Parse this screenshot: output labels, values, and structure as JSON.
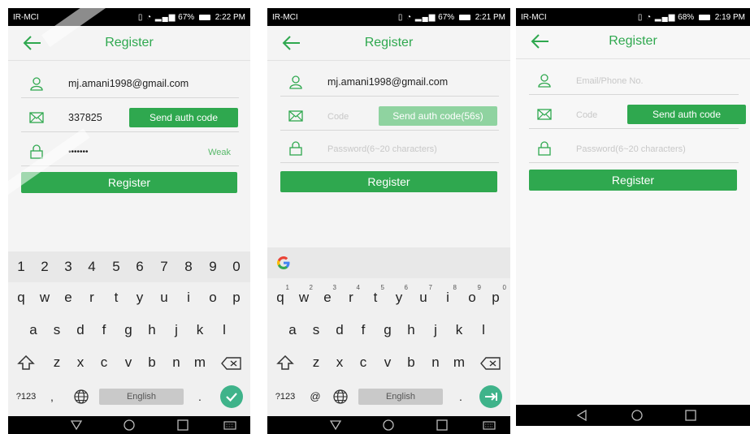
{
  "screens": [
    {
      "status": {
        "carrier": "IR-MCI",
        "battery": "67%",
        "time": "2:22 PM"
      },
      "header": {
        "title": "Register"
      },
      "email_value": "mj.amani1998@gmail.com",
      "code_value": "337825",
      "auth_button": "Send auth code",
      "password_value": "•••••••",
      "strength": "Weak",
      "register_button": "Register"
    },
    {
      "status": {
        "carrier": "IR-MCI",
        "battery": "67%",
        "time": "2:21 PM"
      },
      "header": {
        "title": "Register"
      },
      "email_value": "mj.amani1998@gmail.com",
      "code_placeholder": "Code",
      "auth_button": "Send auth code(56s)",
      "password_placeholder": "Password(6~20 characters)",
      "register_button": "Register"
    },
    {
      "status": {
        "carrier": "IR-MCI",
        "battery": "68%",
        "time": "2:19 PM"
      },
      "header": {
        "title": "Register"
      },
      "email_placeholder": "Email/Phone No.",
      "code_placeholder": "Code",
      "auth_button": "Send auth code",
      "password_placeholder": "Password(6~20 characters)",
      "register_button": "Register"
    }
  ],
  "keyboard": {
    "numbers": [
      "1",
      "2",
      "3",
      "4",
      "5",
      "6",
      "7",
      "8",
      "9",
      "0"
    ],
    "row1": [
      "q",
      "w",
      "e",
      "r",
      "t",
      "y",
      "u",
      "i",
      "o",
      "p"
    ],
    "row1_hints": [
      "1",
      "2",
      "3",
      "4",
      "5",
      "6",
      "7",
      "8",
      "9",
      "0"
    ],
    "row2": [
      "a",
      "s",
      "d",
      "f",
      "g",
      "h",
      "j",
      "k",
      "l"
    ],
    "row3": [
      "z",
      "x",
      "c",
      "v",
      "b",
      "n",
      "m"
    ],
    "sym_key": "?123",
    "comma": ",",
    "at": "@",
    "space_label": "English",
    "period": "."
  },
  "colors": {
    "accent": "#2fa84f",
    "accent_disabled": "#8fd3a0",
    "status_bar": "#000000"
  },
  "icons": [
    "back-arrow-icon",
    "user-icon",
    "envelope-icon",
    "lock-icon",
    "shift-icon",
    "backspace-icon",
    "globe-icon",
    "check-icon",
    "enter-icon",
    "google-icon",
    "nav-back-icon",
    "nav-home-icon",
    "nav-recents-icon",
    "nav-keyboard-icon"
  ]
}
